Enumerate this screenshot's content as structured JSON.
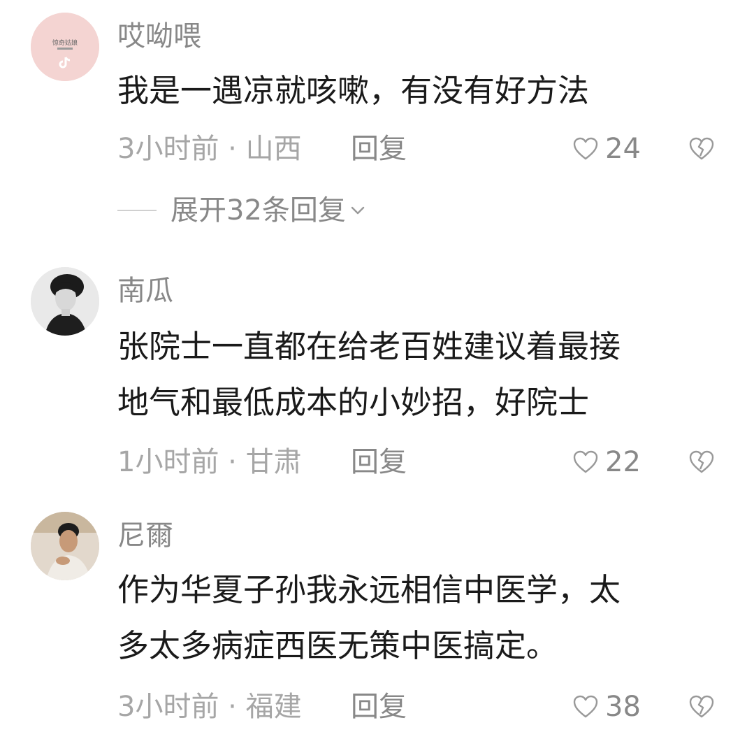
{
  "comments": [
    {
      "username": "哎呦喂",
      "avatar_badge": "惊奇姑娘",
      "text_lines": [
        "我是一遇凉就咳嗽，有没有好方法"
      ],
      "meta": "3小时前 · 山西",
      "reply_label": "回复",
      "likes": "24",
      "expand_label": "展开32条回复"
    },
    {
      "username": "南瓜",
      "text_lines": [
        "张院士一直都在给老百姓建议着最接",
        "地气和最低成本的小妙招，好院士"
      ],
      "meta": "1小时前 · 甘肃",
      "reply_label": "回复",
      "likes": "22"
    },
    {
      "username": "尼爾",
      "text_lines": [
        "作为华夏子孙我永远相信中医学，太",
        "多太多病症西医无策中医搞定。"
      ],
      "meta": "3小时前 · 福建",
      "reply_label": "回复",
      "likes": "38"
    }
  ],
  "icons": {
    "like": "heart-outline-icon",
    "dislike": "broken-heart-icon",
    "expand": "chevron-down-icon"
  },
  "colors": {
    "text": "#1a1a1a",
    "secondary": "#888888",
    "meta": "#a6a6a6",
    "avatar1_bg": "#f3d3d1"
  }
}
